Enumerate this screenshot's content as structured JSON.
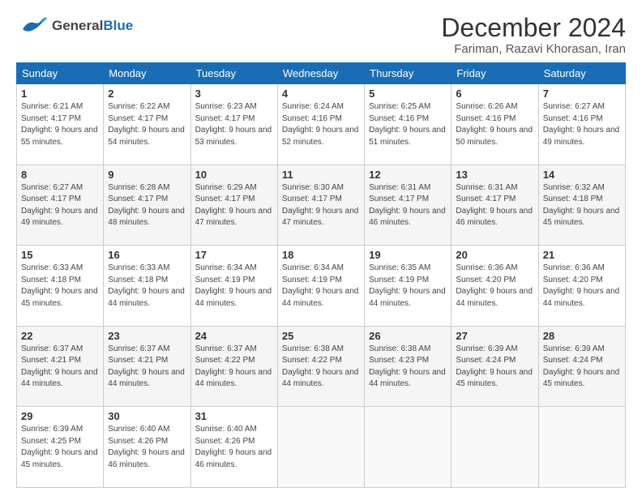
{
  "header": {
    "logo_general": "General",
    "logo_blue": "Blue",
    "month_title": "December 2024",
    "location": "Fariman, Razavi Khorasan, Iran"
  },
  "days_of_week": [
    "Sunday",
    "Monday",
    "Tuesday",
    "Wednesday",
    "Thursday",
    "Friday",
    "Saturday"
  ],
  "weeks": [
    [
      {
        "day": "1",
        "sunrise": "6:21 AM",
        "sunset": "4:17 PM",
        "daylight": "9 hours and 55 minutes."
      },
      {
        "day": "2",
        "sunrise": "6:22 AM",
        "sunset": "4:17 PM",
        "daylight": "9 hours and 54 minutes."
      },
      {
        "day": "3",
        "sunrise": "6:23 AM",
        "sunset": "4:17 PM",
        "daylight": "9 hours and 53 minutes."
      },
      {
        "day": "4",
        "sunrise": "6:24 AM",
        "sunset": "4:16 PM",
        "daylight": "9 hours and 52 minutes."
      },
      {
        "day": "5",
        "sunrise": "6:25 AM",
        "sunset": "4:16 PM",
        "daylight": "9 hours and 51 minutes."
      },
      {
        "day": "6",
        "sunrise": "6:26 AM",
        "sunset": "4:16 PM",
        "daylight": "9 hours and 50 minutes."
      },
      {
        "day": "7",
        "sunrise": "6:27 AM",
        "sunset": "4:16 PM",
        "daylight": "9 hours and 49 minutes."
      }
    ],
    [
      {
        "day": "8",
        "sunrise": "6:27 AM",
        "sunset": "4:17 PM",
        "daylight": "9 hours and 49 minutes."
      },
      {
        "day": "9",
        "sunrise": "6:28 AM",
        "sunset": "4:17 PM",
        "daylight": "9 hours and 48 minutes."
      },
      {
        "day": "10",
        "sunrise": "6:29 AM",
        "sunset": "4:17 PM",
        "daylight": "9 hours and 47 minutes."
      },
      {
        "day": "11",
        "sunrise": "6:30 AM",
        "sunset": "4:17 PM",
        "daylight": "9 hours and 47 minutes."
      },
      {
        "day": "12",
        "sunrise": "6:31 AM",
        "sunset": "4:17 PM",
        "daylight": "9 hours and 46 minutes."
      },
      {
        "day": "13",
        "sunrise": "6:31 AM",
        "sunset": "4:17 PM",
        "daylight": "9 hours and 46 minutes."
      },
      {
        "day": "14",
        "sunrise": "6:32 AM",
        "sunset": "4:18 PM",
        "daylight": "9 hours and 45 minutes."
      }
    ],
    [
      {
        "day": "15",
        "sunrise": "6:33 AM",
        "sunset": "4:18 PM",
        "daylight": "9 hours and 45 minutes."
      },
      {
        "day": "16",
        "sunrise": "6:33 AM",
        "sunset": "4:18 PM",
        "daylight": "9 hours and 44 minutes."
      },
      {
        "day": "17",
        "sunrise": "6:34 AM",
        "sunset": "4:19 PM",
        "daylight": "9 hours and 44 minutes."
      },
      {
        "day": "18",
        "sunrise": "6:34 AM",
        "sunset": "4:19 PM",
        "daylight": "9 hours and 44 minutes."
      },
      {
        "day": "19",
        "sunrise": "6:35 AM",
        "sunset": "4:19 PM",
        "daylight": "9 hours and 44 minutes."
      },
      {
        "day": "20",
        "sunrise": "6:36 AM",
        "sunset": "4:20 PM",
        "daylight": "9 hours and 44 minutes."
      },
      {
        "day": "21",
        "sunrise": "6:36 AM",
        "sunset": "4:20 PM",
        "daylight": "9 hours and 44 minutes."
      }
    ],
    [
      {
        "day": "22",
        "sunrise": "6:37 AM",
        "sunset": "4:21 PM",
        "daylight": "9 hours and 44 minutes."
      },
      {
        "day": "23",
        "sunrise": "6:37 AM",
        "sunset": "4:21 PM",
        "daylight": "9 hours and 44 minutes."
      },
      {
        "day": "24",
        "sunrise": "6:37 AM",
        "sunset": "4:22 PM",
        "daylight": "9 hours and 44 minutes."
      },
      {
        "day": "25",
        "sunrise": "6:38 AM",
        "sunset": "4:22 PM",
        "daylight": "9 hours and 44 minutes."
      },
      {
        "day": "26",
        "sunrise": "6:38 AM",
        "sunset": "4:23 PM",
        "daylight": "9 hours and 44 minutes."
      },
      {
        "day": "27",
        "sunrise": "6:39 AM",
        "sunset": "4:24 PM",
        "daylight": "9 hours and 45 minutes."
      },
      {
        "day": "28",
        "sunrise": "6:39 AM",
        "sunset": "4:24 PM",
        "daylight": "9 hours and 45 minutes."
      }
    ],
    [
      {
        "day": "29",
        "sunrise": "6:39 AM",
        "sunset": "4:25 PM",
        "daylight": "9 hours and 45 minutes."
      },
      {
        "day": "30",
        "sunrise": "6:40 AM",
        "sunset": "4:26 PM",
        "daylight": "9 hours and 46 minutes."
      },
      {
        "day": "31",
        "sunrise": "6:40 AM",
        "sunset": "4:26 PM",
        "daylight": "9 hours and 46 minutes."
      },
      null,
      null,
      null,
      null
    ]
  ],
  "labels": {
    "sunrise": "Sunrise:",
    "sunset": "Sunset:",
    "daylight": "Daylight:"
  }
}
